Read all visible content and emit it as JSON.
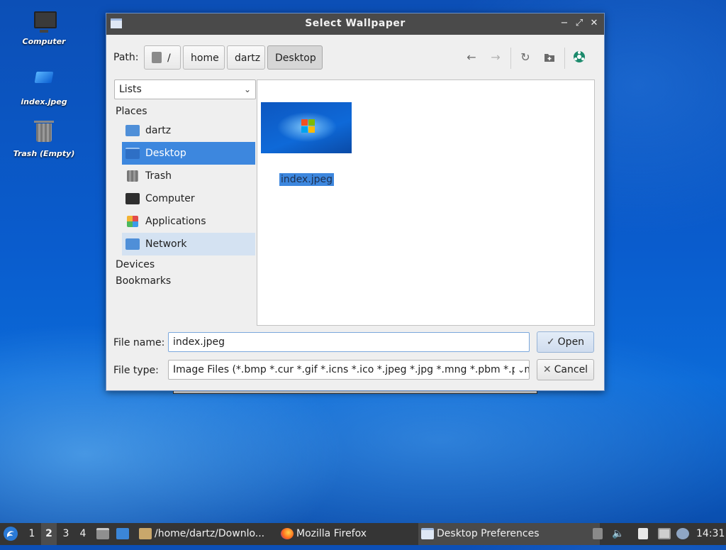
{
  "desktop": {
    "icons": [
      {
        "label": "Computer"
      },
      {
        "label": "index.jpeg"
      },
      {
        "label": "Trash (Empty)"
      }
    ]
  },
  "dialog": {
    "title": "Select Wallpaper",
    "window_buttons": {
      "minimize": "−",
      "maximize": "⤢",
      "close": "✕"
    },
    "path_label": "Path:",
    "breadcrumbs": [
      "/",
      "home",
      "dartz",
      "Desktop"
    ],
    "nav_icons": [
      "back-arrow-icon",
      "forward-arrow-icon",
      "reload-icon",
      "new-folder-icon",
      "web-icon"
    ],
    "view_mode": "Lists",
    "sections": {
      "places": "Places",
      "devices": "Devices",
      "bookmarks": "Bookmarks"
    },
    "places": [
      {
        "label": "dartz",
        "icon": "home-folder-icon"
      },
      {
        "label": "Desktop",
        "icon": "desktop-icon",
        "selected": true
      },
      {
        "label": "Trash",
        "icon": "trash-icon"
      },
      {
        "label": "Computer",
        "icon": "computer-icon"
      },
      {
        "label": "Applications",
        "icon": "applications-icon"
      },
      {
        "label": "Network",
        "icon": "network-icon",
        "hovered": true
      }
    ],
    "files": [
      {
        "name": "index.jpeg",
        "selected": true
      }
    ],
    "file_name_label": "File name:",
    "file_name_value": "index.jpeg",
    "file_type_label": "File type:",
    "file_type_value": "Image Files (*.bmp *.cur *.gif *.icns *.ico *.jpeg *.jpg *.mng *.pbm *.pgm",
    "open_label": "Open",
    "cancel_label": "Cancel"
  },
  "taskbar": {
    "workspaces": [
      "1",
      "2",
      "3",
      "4"
    ],
    "current_workspace": "2",
    "tasks": [
      {
        "label": "/home/dartz/Downlo..."
      },
      {
        "label": "Mozilla Firefox"
      },
      {
        "label": "Desktop Preferences"
      }
    ],
    "clock": "14:31"
  },
  "colors": {
    "selection": "#3d87de",
    "taskbar": "#353535",
    "titlebar": "#4a4a4a"
  }
}
